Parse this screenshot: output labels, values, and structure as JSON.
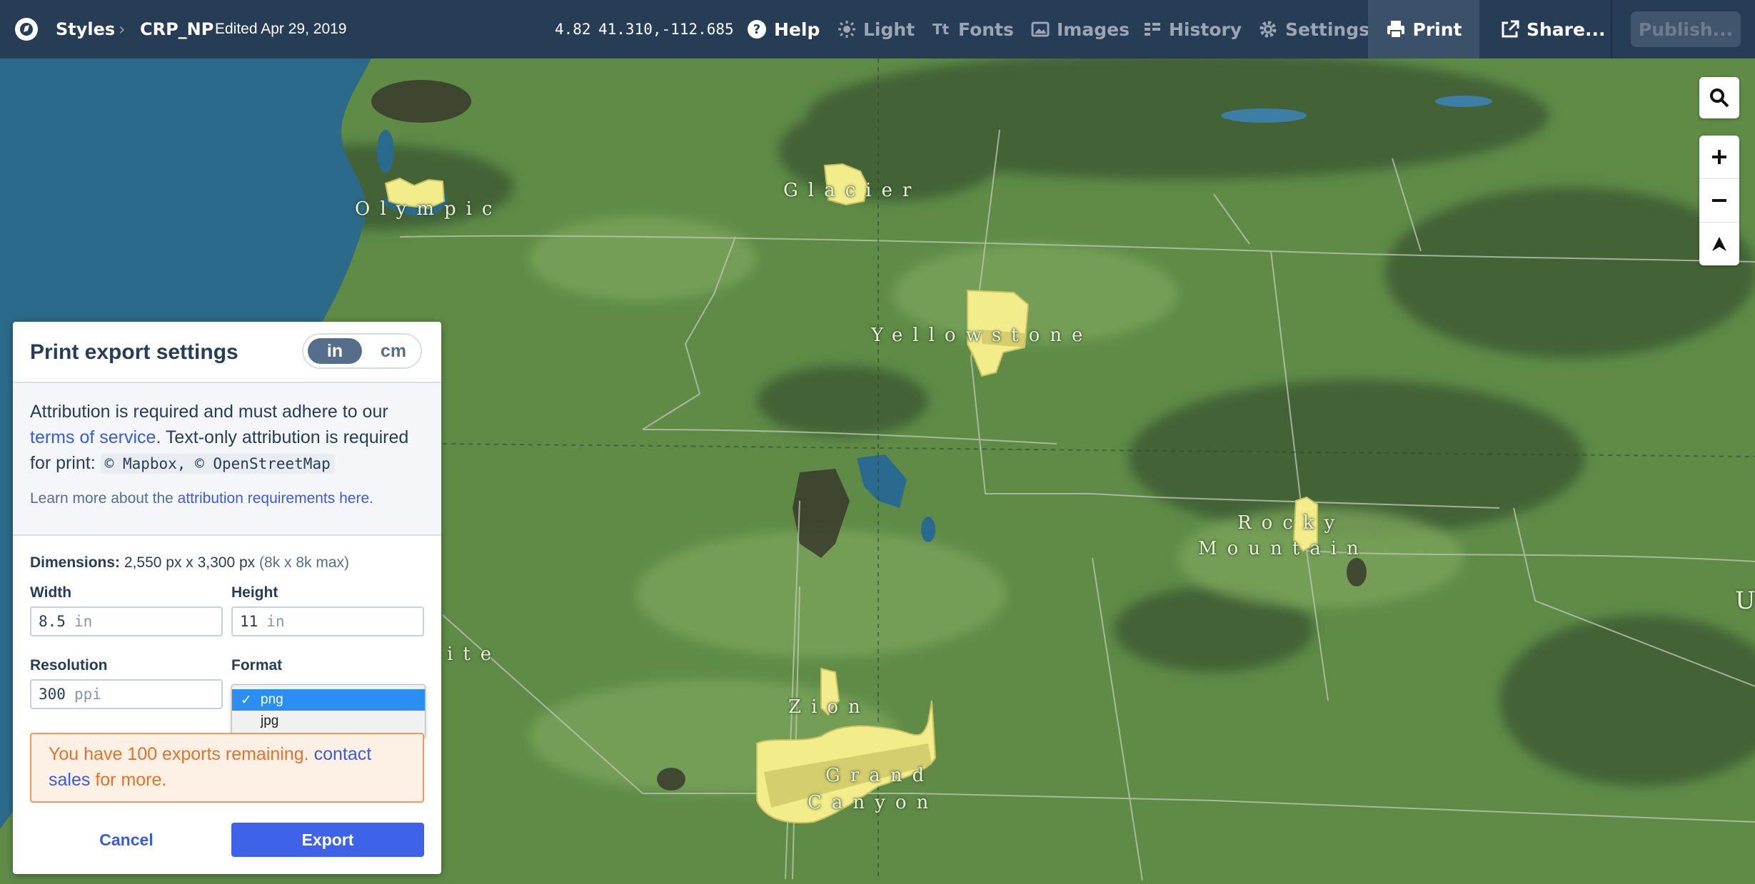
{
  "topbar": {
    "styles_label": "Styles",
    "style_name": "CRP_NP",
    "edited": "Edited Apr 29, 2019",
    "zoom": "4.82",
    "coords": "41.310,-112.685",
    "help": "Help",
    "light": "Light",
    "fonts": "Fonts",
    "images": "Images",
    "history": "History",
    "settings": "Settings",
    "print": "Print",
    "share": "Share...",
    "publish": "Publish..."
  },
  "map": {
    "labels": {
      "olympic": "Olympic",
      "glacier": "Glacier",
      "yellowstone": "Yellowstone",
      "rocky": "Rocky",
      "mountain": "Mountain",
      "zion": "Zion",
      "grand": "Grand",
      "canyon": "Canyon",
      "partial_left": "ite",
      "partial_right": "U"
    }
  },
  "dialog": {
    "title": "Print export settings",
    "unit_in": "in",
    "unit_cm": "cm",
    "attr_text_1": "Attribution is required and must adhere to our",
    "attr_link_tos": "terms of service",
    "attr_text_2": ". Text-only attribution is required for print:",
    "attr_code": "© Mapbox, © OpenStreetMap",
    "learn_prefix": "Learn more about the",
    "learn_link": "attribution requirements here",
    "learn_suffix": ".",
    "dims_label": "Dimensions:",
    "dims_value": "2,550 px x 3,300 px",
    "dims_max": "(8k x 8k max)",
    "width_label": "Width",
    "width_value": "8.5",
    "width_unit": "in",
    "height_label": "Height",
    "height_value": "11",
    "height_unit": "in",
    "resolution_label": "Resolution",
    "resolution_value": "300",
    "resolution_unit": "ppi",
    "format_label": "Format",
    "format_options": [
      "png",
      "jpg"
    ],
    "format_selected": "png",
    "notice_text": "You have 100 exports remaining.",
    "notice_link": "contact sales",
    "notice_suffix": "for more.",
    "cancel": "Cancel",
    "export": "Export"
  },
  "colors": {
    "topbar_bg": "#273d56",
    "water": "#2b6a8a",
    "land": "#5e8a46",
    "accent_blue": "#3e63e8",
    "notice_orange": "#f09a56"
  }
}
